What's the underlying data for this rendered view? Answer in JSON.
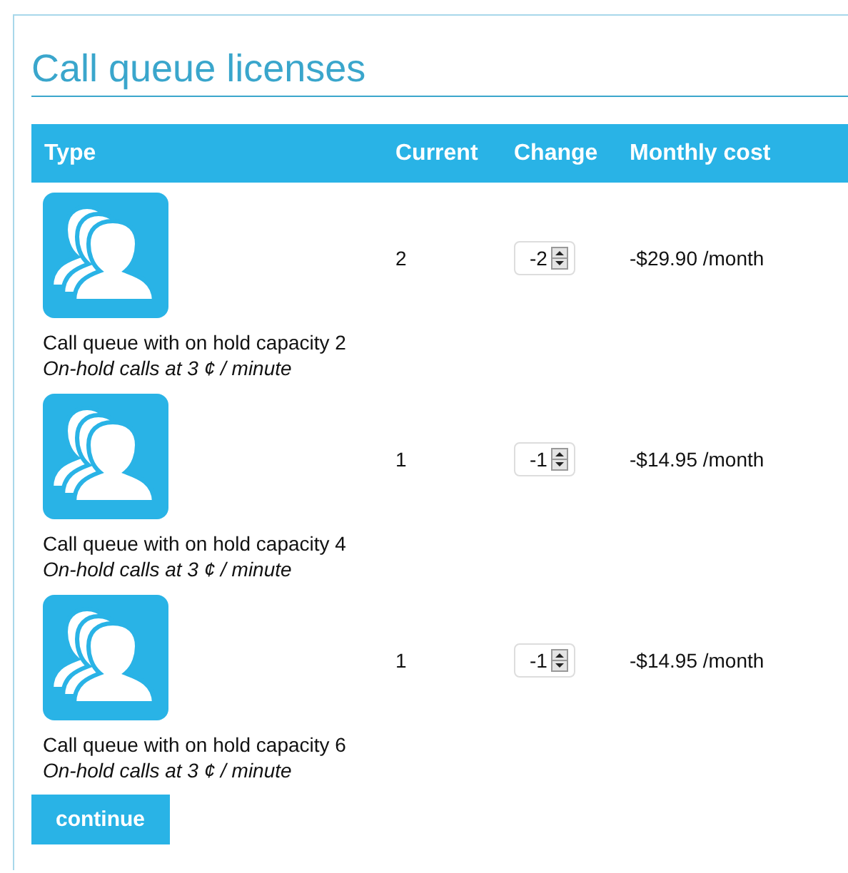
{
  "title": "Call queue licenses",
  "columns": [
    "Type",
    "Current",
    "Change",
    "Monthly cost"
  ],
  "rows": [
    {
      "name": "Call queue with on hold capacity 2",
      "note": "On-hold calls at 3 ¢ / minute",
      "current": "2",
      "change": "-2",
      "cost": "-$29.90 /month"
    },
    {
      "name": "Call queue with on hold capacity 4",
      "note": "On-hold calls at 3 ¢ / minute",
      "current": "1",
      "change": "-1",
      "cost": "-$14.95 /month"
    },
    {
      "name": "Call queue with on hold capacity 6",
      "note": "On-hold calls at 3 ¢ / minute",
      "current": "1",
      "change": "-1",
      "cost": "-$14.95 /month"
    }
  ],
  "button": "continue"
}
